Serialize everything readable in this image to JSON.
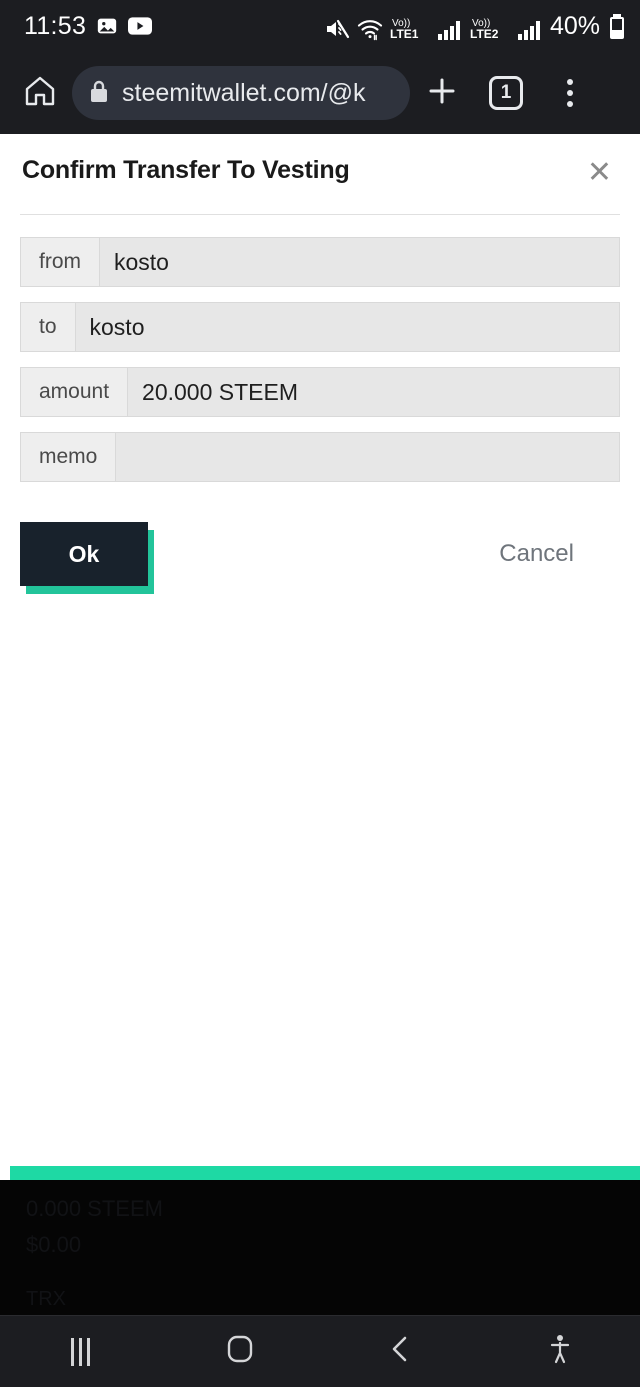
{
  "status_bar": {
    "time": "11:53",
    "left_icons": [
      "photo-icon",
      "youtube-icon"
    ],
    "right_icons": [
      "mute-icon",
      "wifi-icon",
      "volte1-icon",
      "signal1-icon",
      "volte2-icon",
      "signal2-icon"
    ],
    "volte1_label": "LTE1",
    "volte2_label": "LTE2",
    "volte_prefix": "Vo))",
    "battery_percent": "40%"
  },
  "browser": {
    "home_icon": "home-icon",
    "lock_icon": "lock-icon",
    "url": "steemitwallet.com/@k",
    "new_tab_icon": "plus-icon",
    "tab_count": "1",
    "menu_icon": "overflow-menu-icon"
  },
  "dialog": {
    "title": "Confirm Transfer To Vesting",
    "close_label": "✕",
    "fields": [
      {
        "label": "from",
        "value": "kosto"
      },
      {
        "label": "to",
        "value": "kosto"
      },
      {
        "label": "amount",
        "value": "20.000 STEEM"
      },
      {
        "label": "memo",
        "value": ""
      }
    ],
    "ok_label": "Ok",
    "cancel_label": "Cancel",
    "accent_color": "#1ed9a4",
    "ok_bg_color": "#18222c"
  },
  "background_strip": {
    "accent_color": "#1ed9a4",
    "line1": "0.000 STEEM",
    "line2": "$0.00",
    "line3": "TRX"
  },
  "nav_bar": {
    "recents_icon": "recents-icon",
    "home_icon": "home-square-icon",
    "back_icon": "back-chevron-icon",
    "accessibility_icon": "accessibility-icon"
  }
}
